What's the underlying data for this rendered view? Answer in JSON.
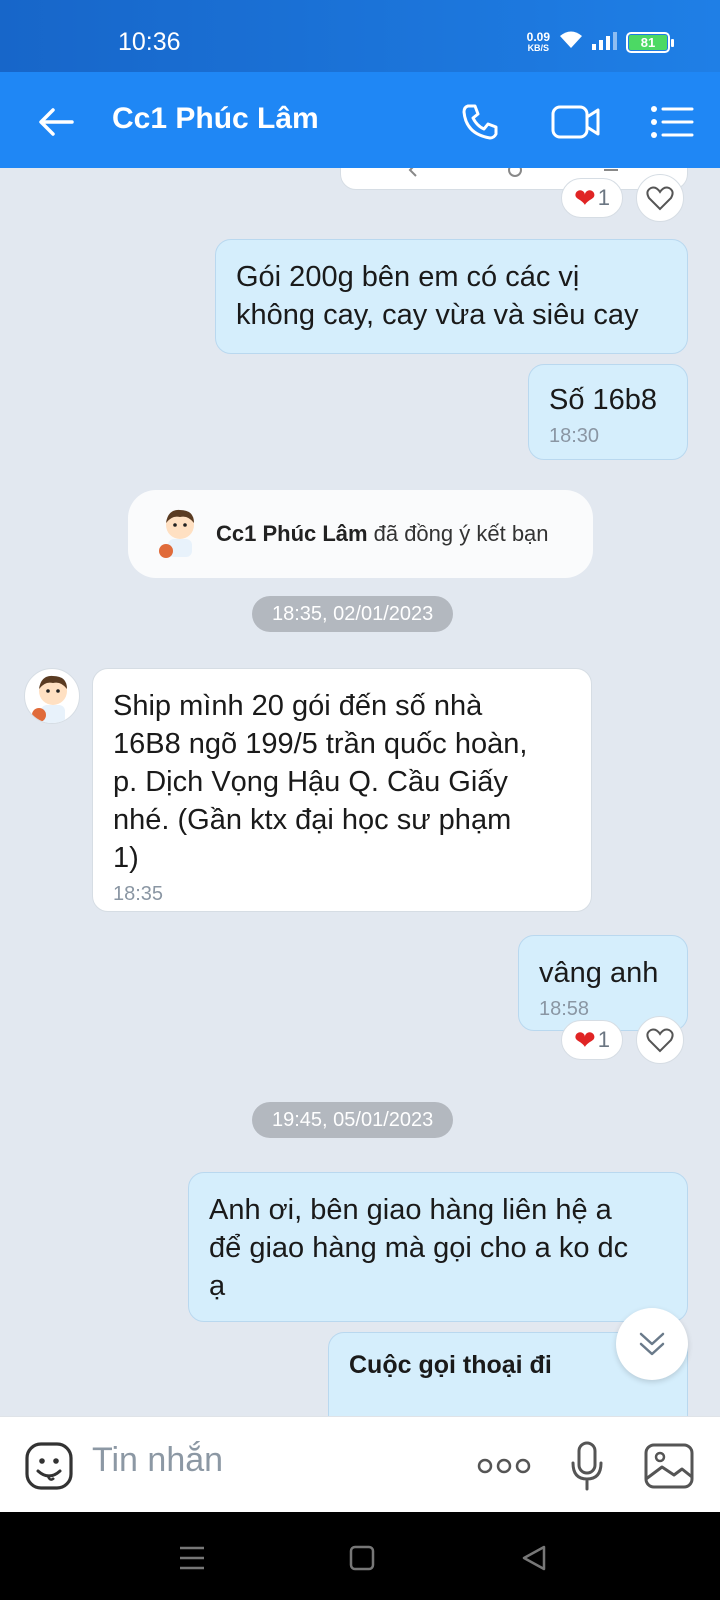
{
  "status": {
    "time": "10:36",
    "net_speed_value": "0.09",
    "net_speed_unit": "KB/S",
    "battery": "81"
  },
  "header": {
    "title": "Cc1 Phúc Lâm"
  },
  "messages": {
    "m1": {
      "text": "Gói 200g bên em có các vị\nkhông cay, cay vừa và siêu cay"
    },
    "m2": {
      "text": "Số 16b8",
      "time": "18:30"
    },
    "friend_notice": {
      "name": "Cc1 Phúc Lâm",
      "text": "đã đồng ý kết bạn"
    },
    "date1": "18:35, 02/01/2023",
    "m3": {
      "text": "Ship mình 20 gói đến số nhà\n16B8 ngõ 199/5 trần quốc hoàn,\np. Dịch Vọng Hậu Q. Cầu Giấy\nnhé. (Gần ktx đại học sư phạm\n1)",
      "time": "18:35"
    },
    "m4": {
      "text": "vâng anh",
      "time": "18:58"
    },
    "date2": "19:45, 05/01/2023",
    "m5": {
      "text": "Anh ơi, bên giao hàng liên hệ a\nđể giao hàng mà gọi cho a ko dc\nạ"
    },
    "m6": {
      "text": "Cuộc gọi thoại đi"
    }
  },
  "reactions": {
    "r1_count": "1",
    "r2_count": "1"
  },
  "input": {
    "placeholder": "Tin nhắn"
  },
  "colors": {
    "header": "#1f87f5",
    "out_bubble": "#d5eefc",
    "heart": "#e02424"
  }
}
